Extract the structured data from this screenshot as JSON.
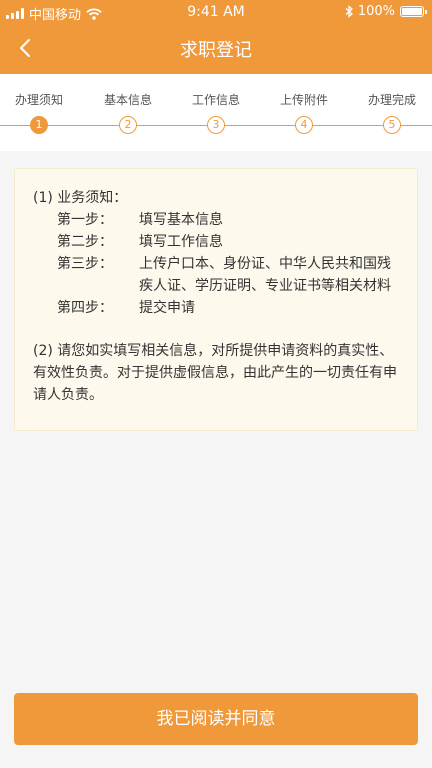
{
  "status_bar": {
    "carrier": "中国移动",
    "time": "9:41 AM",
    "battery_percent": "100%",
    "battery_level": 1.0
  },
  "nav": {
    "title": "求职登记"
  },
  "steps": [
    {
      "label": "办理须知",
      "number": "1"
    },
    {
      "label": "基本信息",
      "number": "2"
    },
    {
      "label": "工作信息",
      "number": "3"
    },
    {
      "label": "上传附件",
      "number": "4"
    },
    {
      "label": "办理完成",
      "number": "5"
    }
  ],
  "notice": {
    "section1_title": "(1) 业务须知：",
    "steps": [
      {
        "key": "第一步：",
        "text": "填写基本信息"
      },
      {
        "key": "第二步：",
        "text": "填写工作信息"
      },
      {
        "key": "第三步：",
        "text": "上传户口本、身份证、中华人民共和国残疾人证、学历证明、专业证书等相关材料"
      },
      {
        "key": "第四步：",
        "text": "提交申请"
      }
    ],
    "section2": "(2) 请您如实填写相关信息，对所提供申请资料的真实性、有效性负责。对于提供虚假信息，由此产生的一切责任有申请人负责。"
  },
  "agree_button": {
    "label": "我已阅读并同意"
  }
}
